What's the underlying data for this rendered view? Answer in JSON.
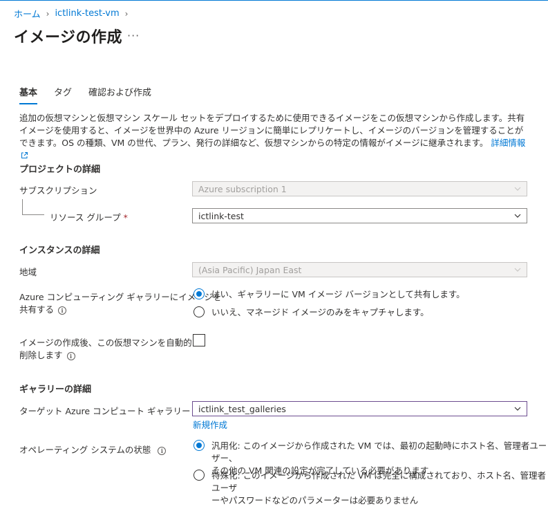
{
  "breadcrumb": {
    "home": "ホーム",
    "vm": "ictlink-test-vm",
    "sep": "›"
  },
  "page": {
    "title": "イメージの作成",
    "more": "···"
  },
  "tabs": [
    {
      "label": "基本",
      "active": true
    },
    {
      "label": "タグ",
      "active": false
    },
    {
      "label": "確認および作成",
      "active": false
    }
  ],
  "description": {
    "text": "追加の仮想マシンと仮想マシン スケール セットをデプロイするために使用できるイメージをこの仮想マシンから作成します。共有イメージを使用すると、イメージを世界中の Azure リージョンに簡単にレプリケートし、イメージのバージョンを管理することができます。OS の種類、VM の世代、プラン、発行の詳細など、仮想マシンからの特定の情報がイメージに継承されます。",
    "link": "詳細情報"
  },
  "project": {
    "heading": "プロジェクトの詳細",
    "subscription_label": "サブスクリプション",
    "subscription_value": "Azure subscription 1",
    "rg_label": "リソース グループ",
    "rg_value": "ictlink-test",
    "required_mark": "*"
  },
  "instance": {
    "heading": "インスタンスの詳細",
    "region_label": "地域",
    "region_value": "(Asia Pacific) Japan East",
    "share_label_line1": "Azure コンピューティング ギャラリーにイメージを",
    "share_label_line2": "共有する",
    "share_yes": "はい、ギャラリーに VM イメージ バージョンとして共有します。",
    "share_no": "いいえ、マネージド イメージのみをキャプチャします。",
    "delete_label_line1": "イメージの作成後、この仮想マシンを自動的に",
    "delete_label_line2": "削除します",
    "delete_checked": false
  },
  "gallery": {
    "heading": "ギャラリーの詳細",
    "target_label": "ターゲット Azure コンピュート ギャラリー",
    "required_mark": "*",
    "target_value": "ictlink_test_galleries",
    "create_new": "新規作成",
    "os_state_label": "オペレーティング システムの状態",
    "generalized_line1": "汎用化: このイメージから作成された VM では、最初の起動時にホスト名、管理者ユーザー、",
    "generalized_line2": "その他の VM 関連の設定が完了している必要があります",
    "specialized_line1": "特殊化: このイメージから作成された VM は完全に構成されており、ホスト名、管理者ユーザ",
    "specialized_line2": "ーやパスワードなどのパラメーターは必要ありません"
  },
  "icons": {
    "info": "i"
  },
  "colors": {
    "accent": "#0078d4",
    "required": "#a4262c",
    "focus_border": "#6b4b8f"
  }
}
